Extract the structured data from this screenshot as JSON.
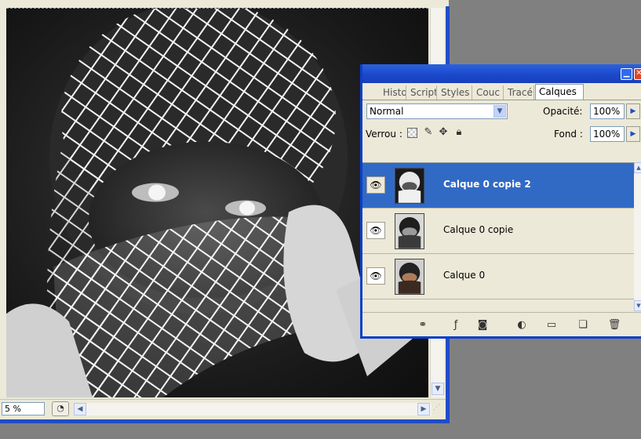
{
  "document": {
    "zoom_value": "5 %",
    "nav_icon": "navigator-icon"
  },
  "palette": {
    "tabs": [
      {
        "label": "Histor",
        "active": false
      },
      {
        "label": "Script",
        "active": false
      },
      {
        "label": "Styles",
        "active": false
      },
      {
        "label": "Couc",
        "active": false
      },
      {
        "label": "Tracé",
        "active": false
      },
      {
        "label": "Calques",
        "active": true
      }
    ],
    "blend_mode": "Normal",
    "opacity_label": "Opacité:",
    "opacity_value": "100%",
    "lock_label": "Verrou :",
    "fill_label": "Fond :",
    "fill_value": "100%",
    "layers": [
      {
        "name": "Calque 0 copie 2",
        "selected": true,
        "visible": true
      },
      {
        "name": "Calque 0 copie",
        "selected": false,
        "visible": true
      },
      {
        "name": "Calque 0",
        "selected": false,
        "visible": true
      }
    ],
    "accent_color": "#316ac5",
    "titlebar_color": "#1a47c9"
  }
}
